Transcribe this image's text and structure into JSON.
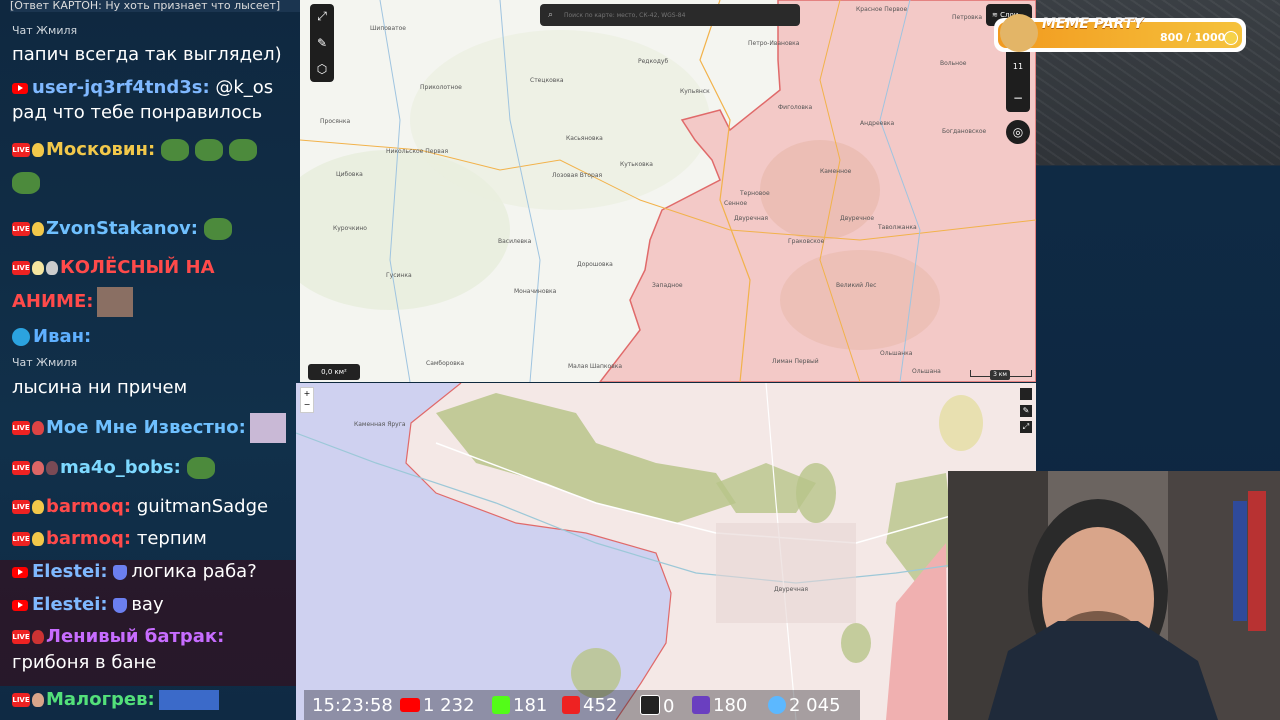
{
  "chat": {
    "reply_text": "[Ответ КАРТОН: Ну хоть признает что лысеет]",
    "lines": [
      {
        "group": "Чат Жмиля"
      },
      {
        "text": "папич всегда так выглядел)"
      },
      {
        "user": "user-jq3rf4tnd3s:",
        "text": "@k_os"
      },
      {
        "text": "рад что тебе понравилось"
      },
      {
        "user": "Московин:"
      },
      {
        "user": "ZvonStakanov:"
      },
      {
        "user": "КОЛЁСНЫЙ НА"
      },
      {
        "user": "АНИМЕ:"
      },
      {
        "user": "Иван:"
      },
      {
        "group": "Чат Жмиля"
      },
      {
        "text": "лысина ни причем"
      },
      {
        "user": "Мое Мне Известно:"
      },
      {
        "user": "ma4o_bobs:"
      },
      {
        "user": "barmoq:",
        "text": "guitmanSadge"
      },
      {
        "user": "barmoq:",
        "text": "терпим"
      },
      {
        "user": "Elestei:",
        "text": "логика раба?"
      },
      {
        "user": "Elestei:",
        "text": "вау"
      },
      {
        "user": "Ленивый батрак:"
      },
      {
        "text": "грибоня в бане"
      },
      {
        "user": "Малогрев:"
      }
    ],
    "live_badge": "LIVE"
  },
  "map_top": {
    "search_placeholder": "Поиск по карте: место, СК-42, WGS-84",
    "area_value": "0,0 км²",
    "zoom_level": "11",
    "scale_label": "3 км",
    "layers_label": "Слои",
    "places": [
      "Шиповатое",
      "Приколотное",
      "Стецковка",
      "Редкодуб",
      "Петро-Ивановка",
      "Красное Первое",
      "Просянка",
      "Купьянск",
      "Фиголовка",
      "Никольское Первая",
      "Касьяновка",
      "Кутьковка",
      "Богдановское",
      "Цибовка",
      "Лозовая Вторая",
      "Двуречная",
      "Двуречное",
      "Таволжанка",
      "Курочкино",
      "Василевка",
      "Граковское",
      "Гусинка",
      "Дорошовка",
      "Западное",
      "Моначиновка",
      "Сенное",
      "Терновое",
      "Самборовка",
      "Малая Шапковка",
      "Лиман Первый",
      "Ольшана",
      "Великий Лес",
      "Петровка",
      "Вольное",
      "Андреевка",
      "Каменное",
      "Ольшанка"
    ]
  },
  "map_bot": {
    "places": [
      "Каменная Яруга",
      "Двуречная"
    ]
  },
  "meme_party": {
    "title": "MEME PARTY",
    "count": "800 / 1000"
  },
  "stats": {
    "clock": "15:23:58",
    "youtube": "1 232",
    "kick": "181",
    "vk_live": "452",
    "rutube": "0",
    "twitch": "180",
    "viewers": "2 045"
  },
  "colors": {
    "occupied": "#f3c9c7",
    "occupied_border": "#e06a6a",
    "water": "#cfd1f0",
    "forest": "#b8c48a"
  }
}
